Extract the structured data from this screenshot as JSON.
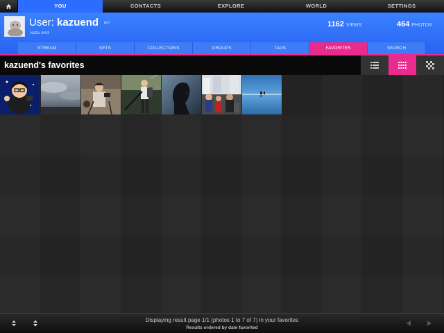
{
  "topnav": {
    "items": [
      {
        "label": "YOU"
      },
      {
        "label": "CONTACTS"
      },
      {
        "label": "EXPLORE"
      },
      {
        "label": "WORLD"
      },
      {
        "label": "SETTINGS"
      }
    ]
  },
  "profile": {
    "prefix": "User:",
    "username": "kazuend",
    "badge": "pro",
    "realname": "kazu end",
    "views_count": "1162",
    "views_label": "VIEWS",
    "photos_count": "464",
    "photos_label": "PHOTOS"
  },
  "tabs": [
    {
      "label": "STREAM"
    },
    {
      "label": "SETS"
    },
    {
      "label": "COLLECTIONS"
    },
    {
      "label": "GROUPS"
    },
    {
      "label": "TAGS"
    },
    {
      "label": "FAVORITES"
    },
    {
      "label": "SEARCH"
    }
  ],
  "page": {
    "title": "kazuend's favorites"
  },
  "footer": {
    "status": "Displaying result page 1/1 (photos 1 to 7 of 7) in your favorites",
    "order": "Results ordered by date favorited"
  },
  "colors": {
    "accent_blue": "#2c6cff",
    "accent_pink": "#ea2b8e",
    "background": "#262626"
  }
}
